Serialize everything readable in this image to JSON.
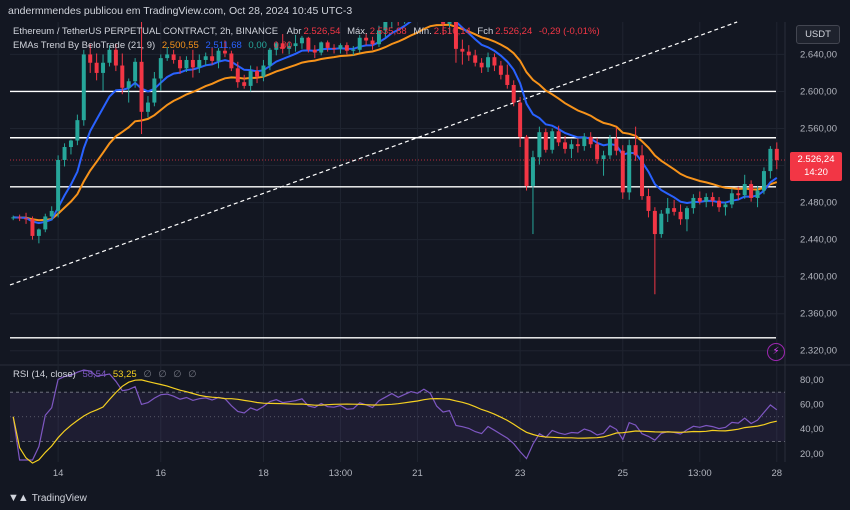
{
  "header": {
    "publisher": "andermmendes publicou em TradingView.com, Oct 28, 2024 10:45 UTC-3"
  },
  "legend": {
    "symbol": "Ethereum / TetherUS PERPETUAL CONTRACT, 2h, BINANCE",
    "open_label": "Abr",
    "open_value": "2.526,54",
    "high_label": "Máx.",
    "high_value": "2.535,88",
    "low_label": "Mín.",
    "low_value": "2.516,14",
    "close_label": "Fch",
    "close_value": "2.526,24",
    "change": "-0,29 (-0,01%)",
    "ema_title": "EMAs Trend By BeloTrade (21, 9)",
    "ema_values": [
      "2.500,55",
      "2.511,68",
      "0,00",
      "0,00"
    ],
    "rsi_title": "RSI (14, close)",
    "rsi_values": [
      "58,54",
      "53,25",
      "∅",
      "∅",
      "∅",
      "∅"
    ]
  },
  "price_axis": {
    "unit": "USDT",
    "last_price": "2.526,24",
    "countdown": "14:20"
  },
  "footer": {
    "brand": "TradingView",
    "logo": "tradingview-logo-icon"
  },
  "colors": {
    "background": "#131722",
    "up": "#26a69a",
    "down": "#f23645",
    "ema_fast": "#2962ff",
    "ema_slow": "#f7931a",
    "rsi": "#7e57c2",
    "rsi_ma": "#f5d021",
    "level_line": "#ffffff"
  },
  "chart_data": {
    "type": "candlestick",
    "price_panel": {
      "ylim": [
        2310,
        2675
      ],
      "y_ticks": [
        "2.640,00",
        "2.600,00",
        "2.560,00",
        "2.520,00",
        "2.480,00",
        "2.440,00",
        "2.400,00",
        "2.360,00",
        "2.320,00"
      ],
      "y_tick_values": [
        2640,
        2600,
        2560,
        2520,
        2480,
        2440,
        2400,
        2360,
        2320
      ],
      "horizontal_levels": [
        2600,
        2550,
        2497,
        2334
      ],
      "trendline": {
        "from": [
          0,
          2391
        ],
        "to": [
          116,
          2683
        ]
      },
      "x_ticks": [
        {
          "i": 7,
          "label": "14"
        },
        {
          "i": 23,
          "label": "16"
        },
        {
          "i": 39,
          "label": "18"
        },
        {
          "i": 51,
          "label": "13:00"
        },
        {
          "i": 63,
          "label": "21"
        },
        {
          "i": 79,
          "label": "23"
        },
        {
          "i": 95,
          "label": "25"
        },
        {
          "i": 107,
          "label": "13:00"
        },
        {
          "i": 119,
          "label": "28"
        }
      ],
      "candles": [
        [
          2464,
          2466,
          2461,
          2464
        ],
        [
          2464,
          2467,
          2460,
          2463
        ],
        [
          2463,
          2469,
          2457,
          2462
        ],
        [
          2462,
          2465,
          2440,
          2444
        ],
        [
          2444,
          2452,
          2436,
          2451
        ],
        [
          2451,
          2468,
          2448,
          2465
        ],
        [
          2465,
          2476,
          2461,
          2471
        ],
        [
          2471,
          2531,
          2464,
          2526
        ],
        [
          2526,
          2544,
          2519,
          2540
        ],
        [
          2540,
          2548,
          2532,
          2547
        ],
        [
          2547,
          2575,
          2542,
          2569
        ],
        [
          2569,
          2645,
          2563,
          2640
        ],
        [
          2640,
          2651,
          2620,
          2631
        ],
        [
          2631,
          2641,
          2612,
          2620
        ],
        [
          2620,
          2640,
          2601,
          2631
        ],
        [
          2631,
          2650,
          2627,
          2645
        ],
        [
          2645,
          2651,
          2622,
          2628
        ],
        [
          2628,
          2641,
          2597,
          2604
        ],
        [
          2604,
          2614,
          2588,
          2611
        ],
        [
          2611,
          2636,
          2604,
          2632
        ],
        [
          2632,
          2688,
          2554,
          2578
        ],
        [
          2578,
          2595,
          2572,
          2588
        ],
        [
          2588,
          2621,
          2584,
          2614
        ],
        [
          2614,
          2640,
          2601,
          2636
        ],
        [
          2636,
          2648,
          2633,
          2640
        ],
        [
          2640,
          2645,
          2630,
          2634
        ],
        [
          2634,
          2638,
          2619,
          2625
        ],
        [
          2625,
          2638,
          2621,
          2634
        ],
        [
          2634,
          2645,
          2615,
          2626
        ],
        [
          2626,
          2640,
          2620,
          2634
        ],
        [
          2634,
          2642,
          2628,
          2638
        ],
        [
          2638,
          2648,
          2629,
          2633
        ],
        [
          2633,
          2647,
          2625,
          2644
        ],
        [
          2644,
          2655,
          2637,
          2641
        ],
        [
          2641,
          2644,
          2622,
          2625
        ],
        [
          2625,
          2632,
          2604,
          2610
        ],
        [
          2610,
          2618,
          2603,
          2606
        ],
        [
          2606,
          2628,
          2600,
          2622
        ],
        [
          2622,
          2627,
          2609,
          2616
        ],
        [
          2616,
          2634,
          2611,
          2628
        ],
        [
          2628,
          2647,
          2623,
          2645
        ],
        [
          2645,
          2654,
          2639,
          2652
        ],
        [
          2652,
          2662,
          2641,
          2646
        ],
        [
          2646,
          2654,
          2640,
          2649
        ],
        [
          2649,
          2661,
          2643,
          2652
        ],
        [
          2652,
          2660,
          2646,
          2658
        ],
        [
          2658,
          2659,
          2642,
          2645
        ],
        [
          2645,
          2650,
          2636,
          2642
        ],
        [
          2642,
          2654,
          2639,
          2653
        ],
        [
          2653,
          2655,
          2643,
          2647
        ],
        [
          2647,
          2651,
          2641,
          2646
        ],
        [
          2646,
          2652,
          2641,
          2650
        ],
        [
          2650,
          2653,
          2640,
          2644
        ],
        [
          2644,
          2649,
          2639,
          2645
        ],
        [
          2645,
          2661,
          2642,
          2658
        ],
        [
          2658,
          2663,
          2650,
          2655
        ],
        [
          2655,
          2659,
          2645,
          2651
        ],
        [
          2651,
          2671,
          2648,
          2666
        ],
        [
          2666,
          2679,
          2659,
          2675
        ],
        [
          2675,
          2689,
          2669,
          2685
        ],
        [
          2685,
          2688,
          2671,
          2680
        ],
        [
          2680,
          2692,
          2673,
          2688
        ],
        [
          2688,
          2699,
          2683,
          2696
        ],
        [
          2696,
          2702,
          2687,
          2694
        ],
        [
          2694,
          2711,
          2690,
          2706
        ],
        [
          2706,
          2716,
          2696,
          2701
        ],
        [
          2701,
          2706,
          2679,
          2683
        ],
        [
          2683,
          2690,
          2661,
          2673
        ],
        [
          2673,
          2686,
          2662,
          2676
        ],
        [
          2676,
          2681,
          2631,
          2646
        ],
        [
          2646,
          2656,
          2629,
          2643
        ],
        [
          2643,
          2650,
          2633,
          2639
        ],
        [
          2639,
          2645,
          2627,
          2631
        ],
        [
          2631,
          2636,
          2620,
          2626
        ],
        [
          2626,
          2642,
          2621,
          2637
        ],
        [
          2637,
          2641,
          2622,
          2628
        ],
        [
          2628,
          2633,
          2613,
          2618
        ],
        [
          2618,
          2629,
          2603,
          2607
        ],
        [
          2607,
          2612,
          2584,
          2588
        ],
        [
          2588,
          2594,
          2540,
          2551
        ],
        [
          2551,
          2553,
          2493,
          2498
        ],
        [
          2498,
          2536,
          2446,
          2529
        ],
        [
          2529,
          2562,
          2521,
          2556
        ],
        [
          2556,
          2560,
          2534,
          2537
        ],
        [
          2537,
          2560,
          2533,
          2557
        ],
        [
          2557,
          2563,
          2541,
          2545
        ],
        [
          2545,
          2552,
          2533,
          2538
        ],
        [
          2538,
          2548,
          2528,
          2543
        ],
        [
          2543,
          2549,
          2534,
          2541
        ],
        [
          2541,
          2555,
          2536,
          2551
        ],
        [
          2551,
          2556,
          2539,
          2543
        ],
        [
          2543,
          2550,
          2522,
          2527
        ],
        [
          2527,
          2536,
          2509,
          2531
        ],
        [
          2531,
          2553,
          2527,
          2549
        ],
        [
          2549,
          2561,
          2531,
          2536
        ],
        [
          2536,
          2542,
          2484,
          2491
        ],
        [
          2491,
          2548,
          2483,
          2542
        ],
        [
          2542,
          2562,
          2525,
          2531
        ],
        [
          2531,
          2542,
          2483,
          2487
        ],
        [
          2487,
          2495,
          2464,
          2471
        ],
        [
          2471,
          2475,
          2381,
          2446
        ],
        [
          2446,
          2472,
          2442,
          2468
        ],
        [
          2468,
          2485,
          2459,
          2474
        ],
        [
          2474,
          2483,
          2466,
          2470
        ],
        [
          2470,
          2478,
          2456,
          2462
        ],
        [
          2462,
          2476,
          2449,
          2474
        ],
        [
          2474,
          2489,
          2468,
          2485
        ],
        [
          2485,
          2492,
          2478,
          2481
        ],
        [
          2481,
          2490,
          2475,
          2486
        ],
        [
          2486,
          2491,
          2476,
          2482
        ],
        [
          2482,
          2486,
          2470,
          2475
        ],
        [
          2475,
          2481,
          2466,
          2478
        ],
        [
          2478,
          2495,
          2474,
          2490
        ],
        [
          2490,
          2497,
          2483,
          2488
        ],
        [
          2488,
          2510,
          2484,
          2500
        ],
        [
          2500,
          2504,
          2481,
          2485
        ],
        [
          2485,
          2498,
          2475,
          2493
        ],
        [
          2493,
          2518,
          2489,
          2514
        ],
        [
          2514,
          2541,
          2506,
          2538
        ],
        [
          2538,
          2545,
          2516,
          2526
        ]
      ],
      "ema_9_last": 2511.68,
      "ema_21_last": 2500.55
    },
    "rsi_panel": {
      "ylim": [
        15,
        88
      ],
      "y_ticks": [
        "80,00",
        "60,00",
        "40,00",
        "20,00"
      ],
      "y_tick_values": [
        80,
        60,
        40,
        20
      ],
      "bands": [
        70,
        30
      ],
      "middle": 50,
      "rsi_last": 58.54,
      "rsi_ma_last": 53.25
    }
  }
}
